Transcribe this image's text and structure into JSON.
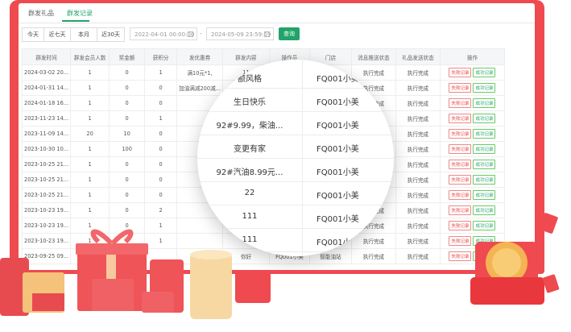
{
  "tabs": [
    {
      "label": "群发礼品",
      "active": false
    },
    {
      "label": "群发记录",
      "active": true
    }
  ],
  "filters": {
    "buttons": [
      "今天",
      "近七天",
      "本月",
      "近30天"
    ],
    "start": "2022-04-01 00:00:00",
    "end": "2024-05-09 23:59:59",
    "separator": "-",
    "query": "查询"
  },
  "table": {
    "headers": [
      "群发时间",
      "群发会员人数",
      "奖金额",
      "获积分",
      "发优惠券",
      "群发内容",
      "操作员",
      "门店",
      "消息推送状态",
      "礼品发送状态",
      "操作"
    ],
    "rows": [
      [
        "2024-03-02 20...",
        "1",
        "0",
        "1",
        "满10元*1,",
        "11",
        "FQ001小美",
        "智能油站",
        "执行完成",
        "执行完成"
      ],
      [
        "2024-01-31 14...",
        "1",
        "0",
        "0",
        "加油满减200减...",
        "",
        "",
        "智能油站",
        "执行完成",
        "执行完成"
      ],
      [
        "2024-01-18 16...",
        "1",
        "0",
        "0",
        "",
        "",
        "",
        "",
        "执行完成",
        "执行完成"
      ],
      [
        "2023-11-23 14...",
        "1",
        "0",
        "1",
        "",
        "",
        "",
        "",
        "执行完成",
        "执行完成"
      ],
      [
        "2023-11-09 14...",
        "20",
        "10",
        "0",
        "",
        "",
        "",
        "",
        "执行完成",
        "执行完成"
      ],
      [
        "2023-10-30 10...",
        "1",
        "100",
        "0",
        "",
        "",
        "",
        "",
        "执行完成",
        "执行完成"
      ],
      [
        "2023-10-25 21...",
        "1",
        "0",
        "0",
        "",
        "",
        "",
        "",
        "执行完成",
        "执行完成"
      ],
      [
        "2023-10-25 21...",
        "1",
        "0",
        "0",
        "",
        "",
        "",
        "",
        "执行完成",
        "执行完成"
      ],
      [
        "2023-10-25 21...",
        "1",
        "0",
        "0",
        "",
        "",
        "",
        "",
        "执行完成",
        "执行完成"
      ],
      [
        "2023-10-23 19...",
        "1",
        "0",
        "2",
        "",
        "",
        "",
        "",
        "执行完成",
        "执行完成"
      ],
      [
        "2023-10-23 19...",
        "1",
        "0",
        "1",
        "",
        "",
        "",
        "",
        "执行完成",
        "执行完成"
      ],
      [
        "2023-10-23 19...",
        "1",
        "0",
        "1",
        "",
        "",
        "",
        "",
        "执行完成",
        "执行完成"
      ],
      [
        "2023-09-25 09...",
        "",
        "",
        "",
        "",
        "你好",
        "FQ001小美",
        "智能油站",
        "执行完成",
        "执行完成"
      ]
    ],
    "ops": {
      "fail": "失败记录",
      "ok": "成功记录"
    }
  },
  "magnifier": [
    [
      "额风格",
      "FQ001小美"
    ],
    [
      "生日快乐",
      "FQ001小美"
    ],
    [
      "92#9.99，柴油...",
      "FQ001小美"
    ],
    [
      "变更有家",
      "FQ001小美"
    ],
    [
      "92#汽油8.99元...",
      "FQ001小美"
    ],
    [
      "22",
      "FQ001小美"
    ],
    [
      "111",
      "FQ001小美"
    ],
    [
      "111",
      "FQ001小美"
    ]
  ],
  "colors": {
    "frame": "#ef4a4f",
    "accent": "#22a36a"
  },
  "icons": [
    "calendar-icon",
    "gift-box-icon",
    "red-envelope-icon",
    "coin-icon"
  ]
}
